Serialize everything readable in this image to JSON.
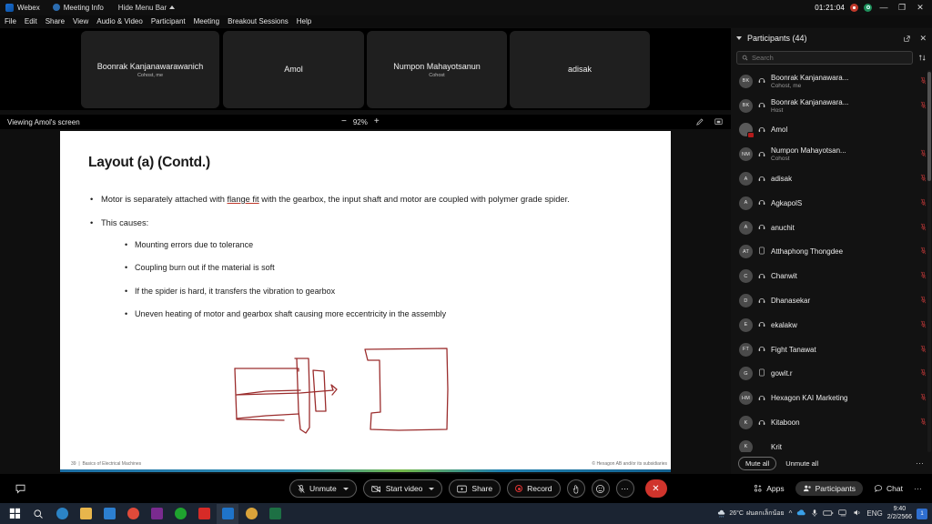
{
  "titlebar": {
    "app_name": "Webex",
    "meeting_info": "Meeting Info",
    "hide_menu_bar": "Hide Menu Bar",
    "timer": "01:21:04",
    "minimize": "—",
    "maximize": "❐",
    "close": "✕"
  },
  "menubar": {
    "items": [
      "File",
      "Edit",
      "Share",
      "View",
      "Audio & Video",
      "Participant",
      "Meeting",
      "Breakout Sessions",
      "Help"
    ]
  },
  "thumbnails": [
    {
      "name": "Boonrak Kanjanawarawanich",
      "role": "Cohost, me"
    },
    {
      "name": "Amol",
      "role": ""
    },
    {
      "name": "Numpon Mahayotsanun",
      "role": "Cohost"
    },
    {
      "name": "adisak",
      "role": ""
    }
  ],
  "sharebar": {
    "title": "Viewing Amol's screen",
    "zoom_out": "−",
    "zoom_level": "92%",
    "zoom_in": "+",
    "annotate_icon": "annotate-icon",
    "fullscreen_icon": "fullscreen-icon"
  },
  "slide": {
    "title": "Layout (a) (Contd.)",
    "bullets": [
      {
        "pre": "Motor is separately attached with ",
        "underline": "flange fit",
        "post": " with the gearbox, the input shaft and motor are coupled with polymer grade spider."
      },
      {
        "pre": "This causes:",
        "underline": "",
        "post": ""
      }
    ],
    "sub_bullets": [
      "Mounting errors due to tolerance",
      "Coupling burn out if the material is soft",
      "If the spider is hard, it transfers the vibration to gearbox",
      "Uneven heating of motor and gearbox shaft causing more eccentricity in the assembly"
    ],
    "footer_page": "39",
    "footer_sep": "|",
    "footer_title": "Basics of Electrical Machines",
    "footer_copyright": "© Hexagon AB and/or its subsidiaries"
  },
  "panel": {
    "title": "Participants (44)",
    "popout_icon": "popout-icon",
    "close_icon": "close-icon",
    "sort_icon": "sort-icon",
    "search_placeholder": "Search",
    "search_value": "",
    "mute_all": "Mute all",
    "unmute_all": "Unmute all",
    "more": "⋯",
    "participants": [
      {
        "initials": "BK",
        "name": "Boonrak Kanjanawara...",
        "role": "Cohost, me",
        "device": "audio-icon",
        "muted": true
      },
      {
        "initials": "BK",
        "name": "Boonrak Kanjanawara...",
        "role": "Host",
        "device": "audio-icon",
        "muted": true
      },
      {
        "initials": "",
        "name": "Amol",
        "role": "",
        "device": "audio-icon",
        "muted": false,
        "sharing": true
      },
      {
        "initials": "NM",
        "name": "Numpon Mahayotsan...",
        "role": "Cohost",
        "device": "audio-icon",
        "muted": true
      },
      {
        "initials": "A",
        "name": "adisak",
        "role": "",
        "device": "audio-icon",
        "muted": true
      },
      {
        "initials": "A",
        "name": "AgkapolS",
        "role": "",
        "device": "audio-icon",
        "muted": true
      },
      {
        "initials": "A",
        "name": "anuchit",
        "role": "",
        "device": "audio-icon",
        "muted": true
      },
      {
        "initials": "AT",
        "name": "Atthaphong Thongdee",
        "role": "",
        "device": "mobile-icon",
        "muted": true
      },
      {
        "initials": "C",
        "name": "Chanwit",
        "role": "",
        "device": "audio-icon",
        "muted": true
      },
      {
        "initials": "D",
        "name": "Dhanasekar",
        "role": "",
        "device": "audio-icon",
        "muted": true
      },
      {
        "initials": "E",
        "name": "ekalakw",
        "role": "",
        "device": "audio-icon",
        "muted": true
      },
      {
        "initials": "FT",
        "name": "Fight Tanawat",
        "role": "",
        "device": "audio-icon",
        "muted": true
      },
      {
        "initials": "G",
        "name": "gowit.r",
        "role": "",
        "device": "mobile-icon",
        "muted": true
      },
      {
        "initials": "HM",
        "name": "Hexagon KAI Marketing",
        "role": "",
        "device": "audio-icon",
        "muted": true
      },
      {
        "initials": "K",
        "name": "Kitaboon",
        "role": "",
        "device": "audio-icon",
        "muted": true
      },
      {
        "initials": "K",
        "name": "Krit",
        "role": "",
        "device": "",
        "muted": false
      }
    ]
  },
  "controlbar": {
    "chat_bubble_icon": "chat-bubble-icon",
    "mute_label": "Unmute",
    "video_label": "Start video",
    "share_label": "Share",
    "record_label": "Record",
    "reactions_icon": "reaction-icon",
    "emoji_icon": "emoji-icon",
    "more_label": "⋯",
    "end_icon": "✕",
    "apps_label": "Apps",
    "participants_label": "Participants",
    "chat_label": "Chat",
    "right_more": "⋯"
  },
  "taskbar": {
    "start_icon": "windows-start-icon",
    "search_icon": "search-icon",
    "apps": [
      {
        "name": "edge-icon",
        "color": "#2b83c5"
      },
      {
        "name": "file-explorer-icon",
        "color": "#e8b64c"
      },
      {
        "name": "mail-icon",
        "color": "#2c7fd0"
      },
      {
        "name": "chrome-icon",
        "color": "#e04a3a"
      },
      {
        "name": "onenote-icon",
        "color": "#7a2b8f"
      },
      {
        "name": "line-icon",
        "color": "#1fa32f"
      },
      {
        "name": "acrobat-icon",
        "color": "#d62b27"
      },
      {
        "name": "webex-icon",
        "color": "#1f74c9"
      },
      {
        "name": "kmplayer-icon",
        "color": "#d9a33a"
      },
      {
        "name": "excel-icon",
        "color": "#1d7044"
      }
    ],
    "weather_temp": "26°C",
    "weather_desc": "ฝนตกเล็กน้อย",
    "language": "ENG",
    "clock_time": "9:40",
    "clock_date": "2/2/2566"
  }
}
